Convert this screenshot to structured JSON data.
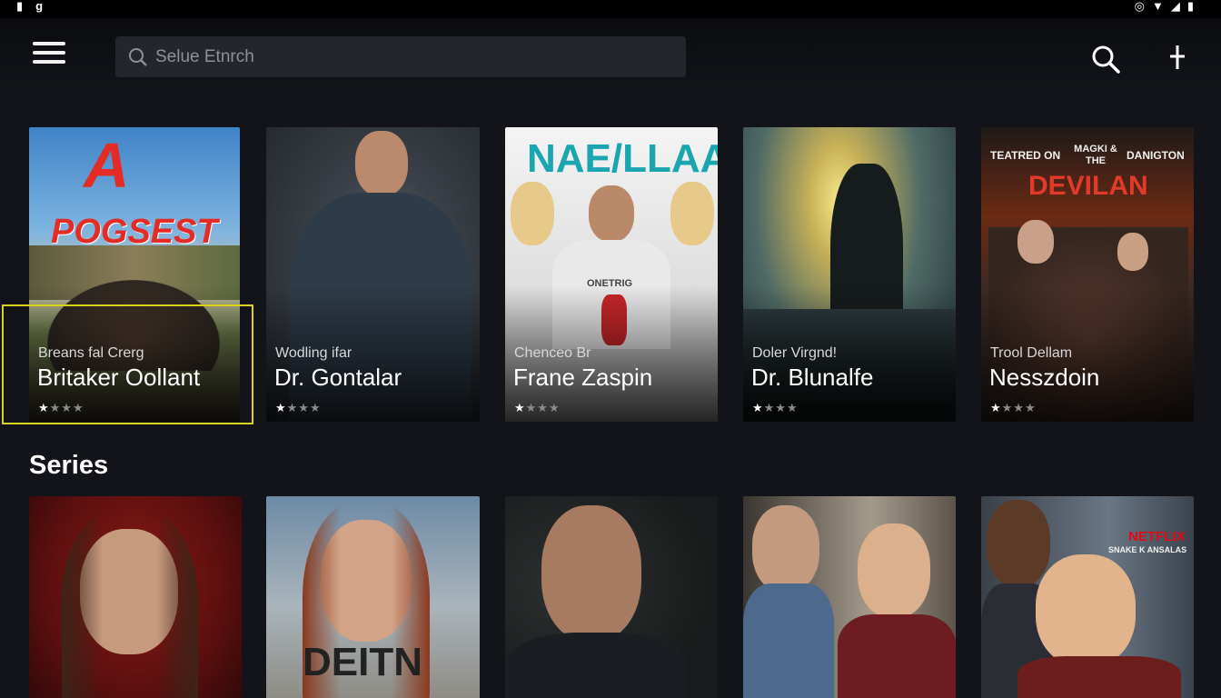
{
  "topbar": {
    "search_placeholder": "Selue Etnrch"
  },
  "movies": [
    {
      "poster_title": "POGSEST",
      "poster_logo": "A",
      "subtitle": "Breans fal Crerg",
      "title": "Britaker Oollant",
      "rating": 1,
      "focused": true
    },
    {
      "subtitle": "Wodling ifar",
      "title": "Dr. Gontalar",
      "rating": 1
    },
    {
      "poster_title": "NAE/LLAAK",
      "poster_shirt": "ONETRIG",
      "subtitle": "Chenceo Br",
      "title": "Frane Zaspin",
      "rating": 1
    },
    {
      "subtitle": "Doler Virgnd!",
      "title": "Dr. Blunalfe",
      "rating": 1
    },
    {
      "poster_top_left": "TEATRED ON",
      "poster_top_mid": "MAGKI & THE",
      "poster_top_right": "DANIGTON",
      "poster_title": "DEVILAN",
      "subtitle": "Trool Dellam",
      "title": "Nesszdoin",
      "rating": 1
    }
  ],
  "series_section": {
    "title": "Series",
    "items": [
      {},
      {
        "poster_text": "DEITN"
      },
      {},
      {},
      {
        "brand": "NETFLIX",
        "brand_sub": "SNAKE K ANSALAS"
      }
    ]
  },
  "rating_max": 4
}
